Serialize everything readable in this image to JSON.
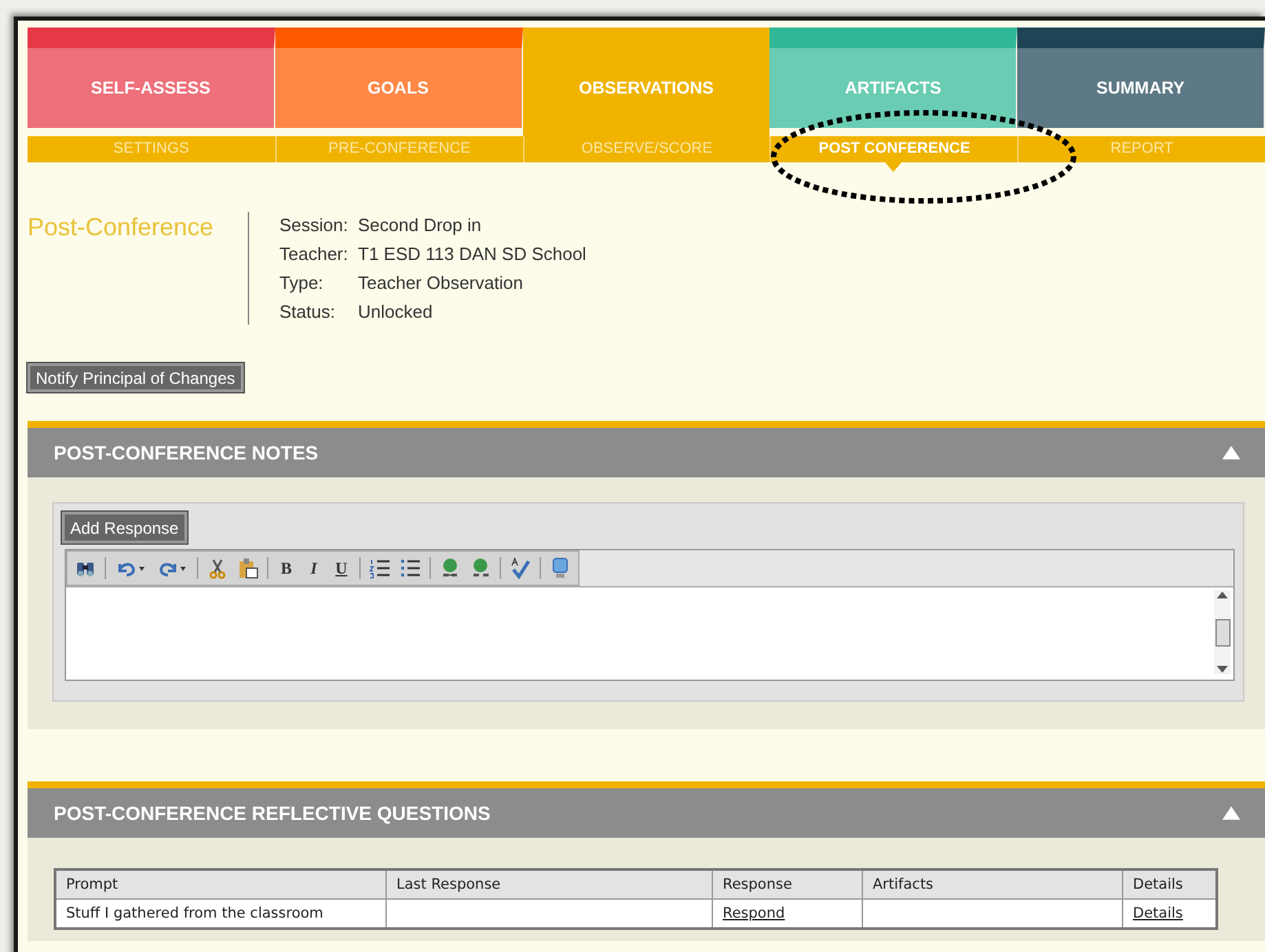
{
  "tabs": [
    {
      "label": "SELF-ASSESS",
      "color": "#e63946",
      "selected": false
    },
    {
      "label": "GOALS",
      "color": "#ff5a00",
      "selected": false
    },
    {
      "label": "OBSERVATIONS",
      "color": "#f0b400",
      "selected": true
    },
    {
      "label": "ARTIFACTS",
      "color": "#2fb895",
      "selected": false
    },
    {
      "label": "SUMMARY",
      "color": "#1e4556",
      "selected": false
    }
  ],
  "subnav": [
    {
      "label": "SETTINGS",
      "selected": false
    },
    {
      "label": "PRE-CONFERENCE",
      "selected": false
    },
    {
      "label": "OBSERVE/SCORE",
      "selected": false
    },
    {
      "label": "POST CONFERENCE",
      "selected": true
    },
    {
      "label": "REPORT",
      "selected": false
    }
  ],
  "page_title": "Post-Conference",
  "details": [
    {
      "label": "Session:",
      "value": "Second Drop in"
    },
    {
      "label": "Teacher:",
      "value": "T1 ESD 113 DAN SD School"
    },
    {
      "label": "Type:",
      "value": "Teacher Observation"
    },
    {
      "label": "Status:",
      "value": "Unlocked"
    }
  ],
  "notify_button": "Notify Principal of Changes",
  "notes_section": {
    "title": "POST-CONFERENCE NOTES",
    "expanded": true,
    "add_button": "Add Response",
    "toolbar": [
      [
        {
          "kind": "find"
        }
      ],
      [
        {
          "kind": "undo"
        },
        {
          "kind": "redo"
        }
      ],
      [
        {
          "kind": "cut"
        },
        {
          "kind": "paste"
        }
      ],
      [
        {
          "kind": "bold",
          "label": "B"
        },
        {
          "kind": "italic",
          "label": "I"
        },
        {
          "kind": "underline",
          "label": "U"
        }
      ],
      [
        {
          "kind": "ordered-list"
        },
        {
          "kind": "bullet-list"
        }
      ],
      [
        {
          "kind": "link"
        },
        {
          "kind": "unlink"
        }
      ],
      [
        {
          "kind": "spellcheck"
        }
      ],
      [
        {
          "kind": "monitor"
        }
      ]
    ]
  },
  "questions_section": {
    "title": "POST-CONFERENCE REFLECTIVE QUESTIONS",
    "expanded": true,
    "table": {
      "columns": [
        "Prompt",
        "Last Response",
        "Response",
        "Artifacts",
        "Details"
      ],
      "rows": [
        {
          "prompt": "Stuff I gathered from the classroom",
          "last_response": "",
          "response": "Respond",
          "artifacts": "",
          "details": "Details"
        }
      ]
    }
  }
}
